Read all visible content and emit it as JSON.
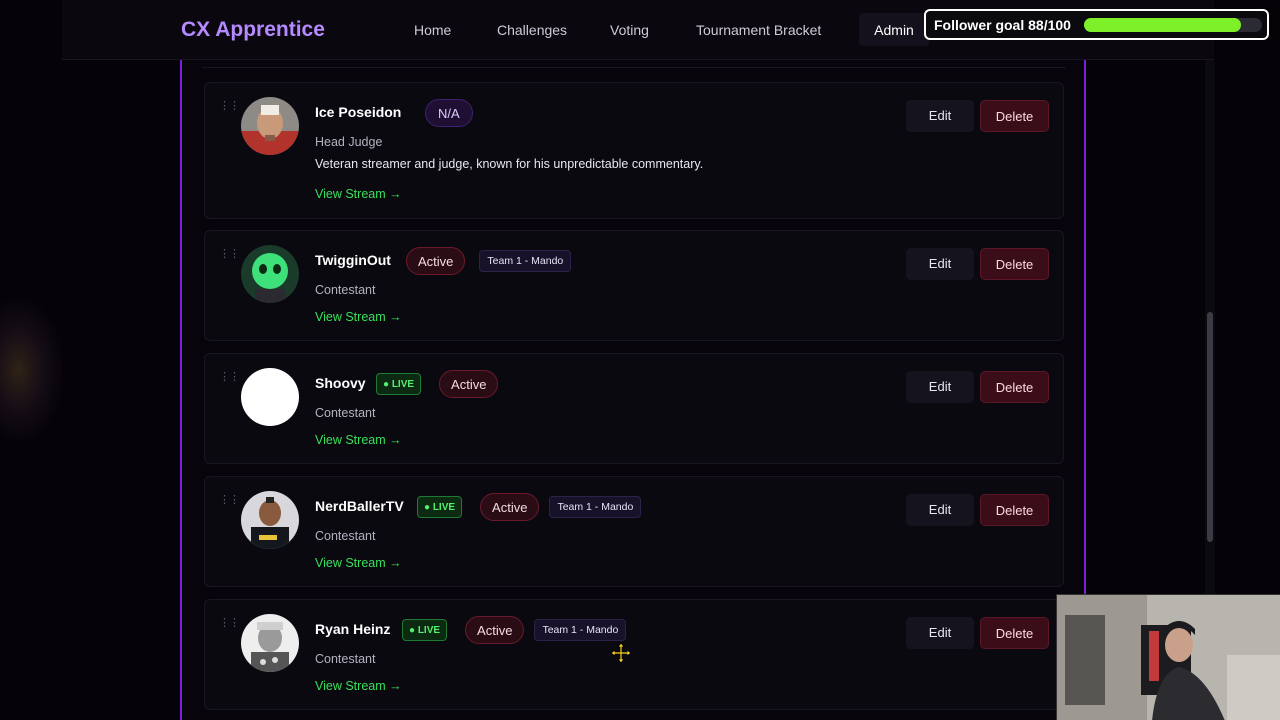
{
  "navbar": {
    "brand": "CX Apprentice",
    "links": [
      "Home",
      "Challenges",
      "Voting",
      "Tournament Bracket"
    ],
    "admin": "Admin"
  },
  "follower_goal": {
    "label": "Follower goal 88/100",
    "current": 88,
    "target": 100,
    "bar_color": "#7ef02a"
  },
  "members": [
    {
      "name": "Ice Poseidon",
      "status_badge": "N/A",
      "live": false,
      "team": "",
      "role": "Head Judge",
      "bio": "Veteran streamer and judge, known for his unpredictable commentary.",
      "link": "View Stream →",
      "edit": "Edit",
      "delete": "Delete"
    },
    {
      "name": "TwigginOut",
      "status_badge": "Active",
      "live": false,
      "team": "Team 1 - Mando",
      "role": "Contestant",
      "link": "View Stream →",
      "edit": "Edit",
      "delete": "Delete"
    },
    {
      "name": "Shoovy",
      "live_label": "● LIVE",
      "status_badge": "Active",
      "live": true,
      "team": "",
      "role": "Contestant",
      "link": "View Stream →",
      "edit": "Edit",
      "delete": "Delete"
    },
    {
      "name": "NerdBallerTV",
      "live_label": "● LIVE",
      "status_badge": "Active",
      "live": true,
      "team": "Team 1 - Mando",
      "role": "Contestant",
      "link": "View Stream →",
      "edit": "Edit",
      "delete": "Delete"
    },
    {
      "name": "Ryan Heinz",
      "live_label": "● LIVE",
      "status_badge": "Active",
      "live": true,
      "team": "Team 1 - Mando",
      "role": "Contestant",
      "link": "View Stream →",
      "edit": "Edit",
      "delete": "Delete"
    }
  ],
  "colors": {
    "brand": "#b589ff",
    "accent_border": "#7a1ed9",
    "link_green": "#37e05a",
    "live_green": "#55ef6e",
    "delete_red": "#3a0d18"
  }
}
